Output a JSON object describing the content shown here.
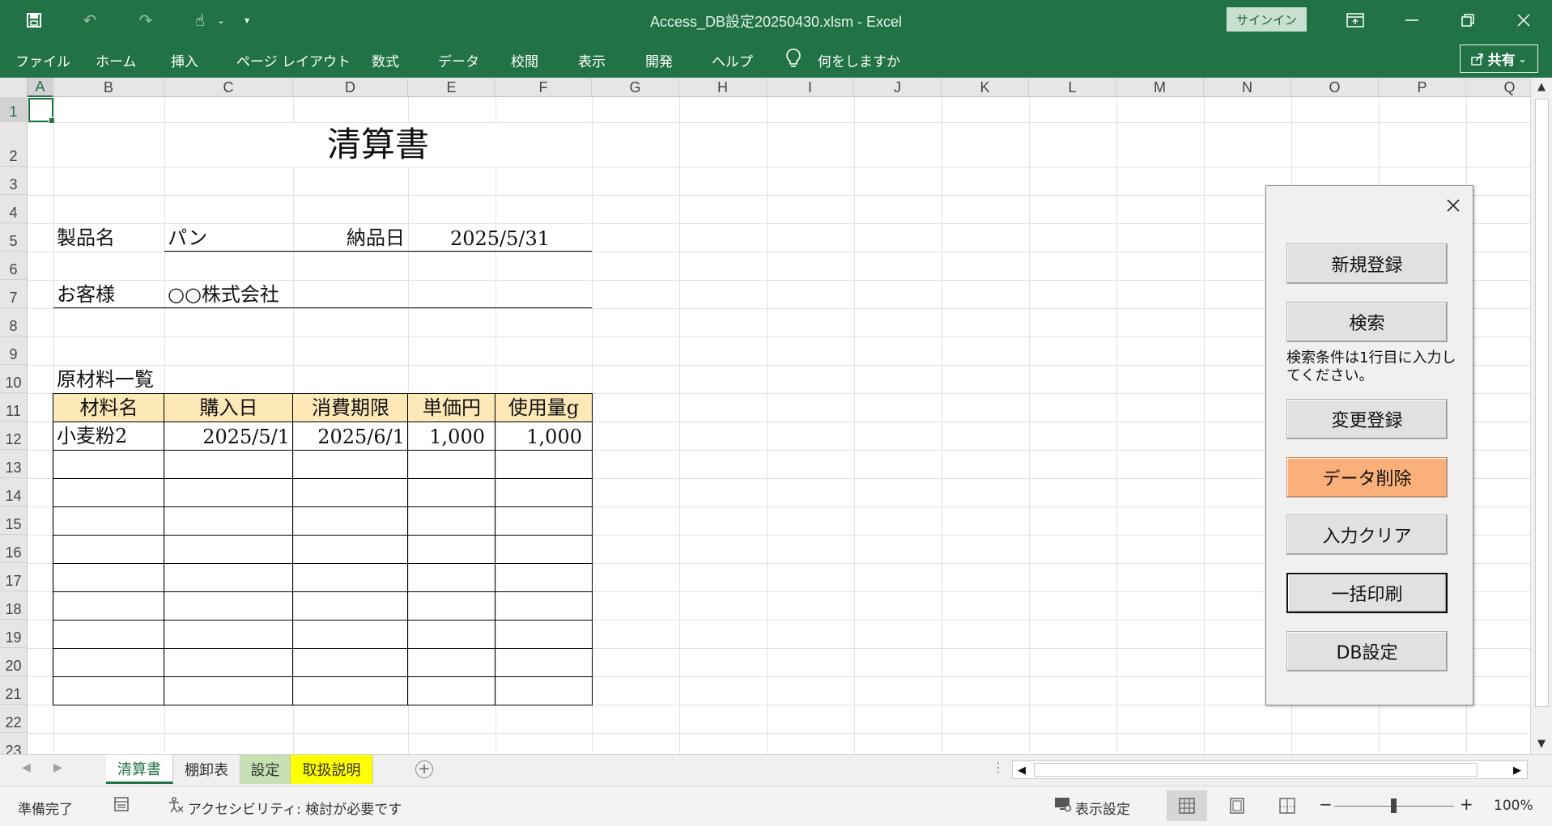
{
  "window": {
    "title": "Access_DB設定20250430.xlsm  -  Excel",
    "signin_label": "サインイン"
  },
  "ribbon": {
    "tabs": [
      "ファイル",
      "ホーム",
      "挿入",
      "ページ レイアウト",
      "数式",
      "データ",
      "校閲",
      "表示",
      "開発",
      "ヘルプ"
    ],
    "tell_me": "何をしますか",
    "share_label": "共有"
  },
  "columns": [
    "A",
    "B",
    "C",
    "D",
    "E",
    "F",
    "G",
    "H",
    "I",
    "J",
    "K",
    "L",
    "M",
    "N",
    "O",
    "P",
    "Q"
  ],
  "rows": [
    "1",
    "2",
    "3",
    "4",
    "5",
    "6",
    "7",
    "8",
    "9",
    "10",
    "11",
    "12",
    "13",
    "14",
    "15",
    "16",
    "17",
    "18",
    "19",
    "20",
    "21",
    "22",
    "23"
  ],
  "sheet": {
    "title": "清算書",
    "product_label": "製品名",
    "product_value": "パン",
    "delivery_label": "納品日",
    "delivery_value": "2025/5/31",
    "customer_label": "お客様",
    "customer_value": "○○株式会社",
    "materials_heading": "原材料一覧",
    "table_headers": [
      "材料名",
      "購入日",
      "消費期限",
      "単価円",
      "使用量g"
    ],
    "table_rows": [
      [
        "小麦粉2",
        "2025/5/1",
        "2025/6/1",
        "1,000",
        "1,000"
      ]
    ]
  },
  "panel": {
    "buttons": [
      "新規登録",
      "検索",
      "変更登録",
      "データ削除",
      "入力クリア",
      "一括印刷",
      "DB設定"
    ],
    "hint": "検索条件は1行目に入力してください。",
    "danger_color": "#fbb07a"
  },
  "sheet_tabs": [
    {
      "label": "清算書",
      "color": "#ffffff"
    },
    {
      "label": "棚卸表",
      "color": "#f0f0f0"
    },
    {
      "label": "設定",
      "color": "#c6e0b4"
    },
    {
      "label": "取扱説明",
      "color": "#ffff00"
    }
  ],
  "status": {
    "ready": "準備完了",
    "accessibility": "アクセシビリティ: 検討が必要です",
    "display_settings": "表示設定",
    "zoom": "100%"
  },
  "theme": {
    "accent": "#217346",
    "header_fill": "#fde9b8"
  }
}
